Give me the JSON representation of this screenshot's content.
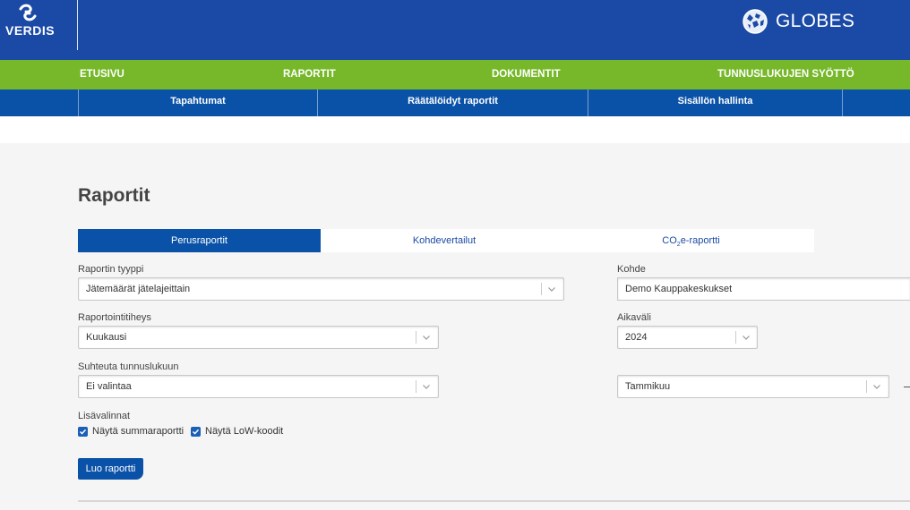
{
  "header": {
    "logo_text": "VERDIS",
    "brand_text": "GLOBES",
    "colors": {
      "header_bg": "#1b4aa6",
      "main_nav_bg": "#76b82a",
      "sub_nav_bg": "#0a52a8"
    }
  },
  "main_nav": {
    "items": [
      {
        "label": "ETUSIVU"
      },
      {
        "label": "RAPORTIT"
      },
      {
        "label": "DOKUMENTIT"
      },
      {
        "label": "TUNNUSLUKUJEN SYÖTTÖ"
      }
    ]
  },
  "sub_nav": {
    "items": [
      {
        "label": "Tapahtumat"
      },
      {
        "label": "Räätälöidyt raportit"
      },
      {
        "label": "Sisällön hallinta"
      }
    ]
  },
  "page": {
    "title": "Raportit"
  },
  "tabs": [
    {
      "label": "Perusraportit",
      "active": true
    },
    {
      "label": "Kohdevertailut",
      "active": false
    },
    {
      "label_prefix": "CO",
      "label_sub": "2",
      "label_suffix": "e-raportti",
      "active": false
    }
  ],
  "form": {
    "report_type": {
      "label": "Raportin tyyppi",
      "value": "Jätemäärät jätelajeittain"
    },
    "target": {
      "label": "Kohde",
      "value": "Demo Kauppakeskukset"
    },
    "frequency": {
      "label": "Raportointitiheys",
      "value": "Kuukausi"
    },
    "period": {
      "label": "Aikaväli",
      "year": "2024",
      "month": "Tammikuu"
    },
    "relate": {
      "label": "Suhteuta tunnuslukuun",
      "value": "Ei valintaa"
    },
    "options": {
      "label": "Lisävalinnat",
      "items": [
        {
          "label": "Näytä summaraportti",
          "checked": true
        },
        {
          "label": "Näytä LoW-koodit",
          "checked": true
        }
      ]
    },
    "submit_label": "Luo raportti"
  }
}
